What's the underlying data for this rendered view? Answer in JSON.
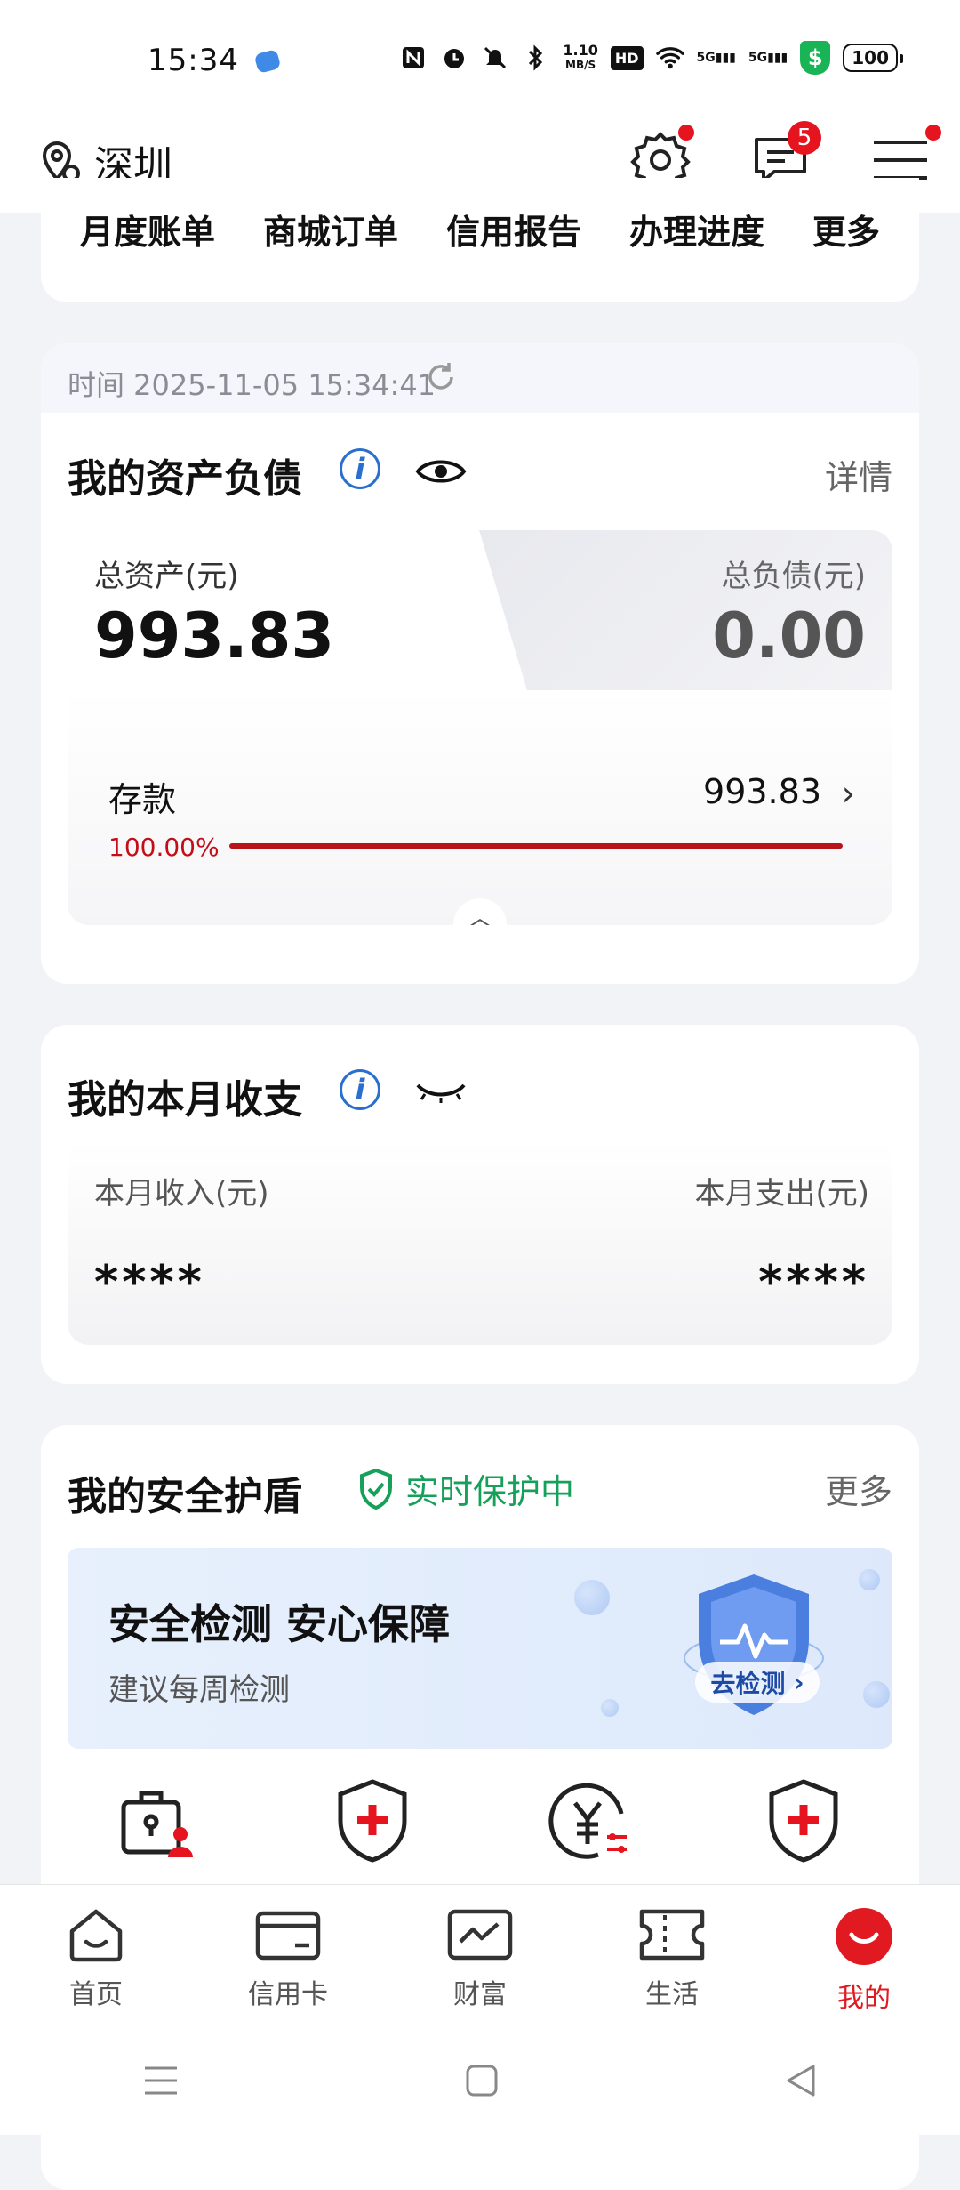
{
  "status_bar": {
    "time": "15:34",
    "net_speed_value": "1.10",
    "net_speed_unit": "MB/S",
    "hd": "HD",
    "sig1": "5G",
    "sig2": "5G",
    "battery": "100",
    "shield_symbol": "$"
  },
  "header": {
    "location": "深圳",
    "messages_badge": "5"
  },
  "quick_menu": {
    "items": [
      "月度账单",
      "商城订单",
      "信用报告",
      "办理进度",
      "更多"
    ]
  },
  "assets": {
    "timestamp": "时间 2025-11-05 15:34:41",
    "title": "我的资产负债",
    "detail_link": "详情",
    "total_assets_label": "总资产(元)",
    "total_assets_value": "993.83",
    "total_liabilities_label": "总负债(元)",
    "total_liabilities_value": "0.00",
    "deposit_label": "存款",
    "deposit_value": "993.83",
    "deposit_percent_text": "100.00%",
    "deposit_percent": 1.0
  },
  "income": {
    "title": "我的本月收支",
    "income_label": "本月收入(元)",
    "expense_label": "本月支出(元)",
    "income_masked": "****",
    "expense_masked": "****"
  },
  "security": {
    "title": "我的安全护盾",
    "status": "实时保护中",
    "more_link": "更多",
    "banner_title": "安全检测 安心保障",
    "banner_subtitle": "建议每周检测",
    "banner_button": "去检测",
    "features": [
      "lock-person-icon",
      "shield-plus-icon",
      "yuan-settings-icon",
      "shield-plus-icon"
    ]
  },
  "tabs": [
    {
      "label": "首页",
      "icon": "home-icon"
    },
    {
      "label": "信用卡",
      "icon": "credit-card-icon"
    },
    {
      "label": "财富",
      "icon": "wealth-chart-icon"
    },
    {
      "label": "生活",
      "icon": "ticket-icon"
    },
    {
      "label": "我的",
      "icon": "profile-icon"
    }
  ],
  "colors": {
    "accent_red": "#e11a22",
    "progress_red": "#b8121a",
    "info_blue": "#2a6fcf",
    "protect_green": "#16a05a"
  }
}
